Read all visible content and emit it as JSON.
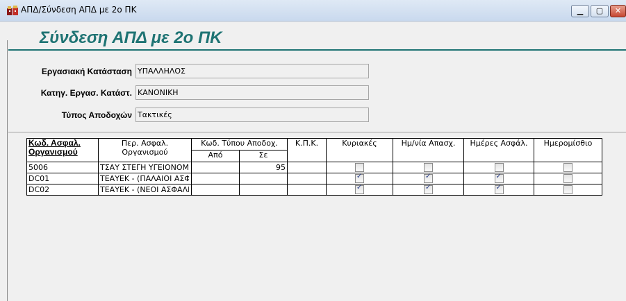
{
  "window": {
    "title": "ΑΠΔ/Σύνδεση ΑΠΔ με 2ο ΠΚ",
    "minimize_glyph": "▁",
    "maximize_glyph": "▢",
    "close_glyph": "✕",
    "icon": "app-icon"
  },
  "form": {
    "heading": "Σύνδεση ΑΠΔ με 2ο ΠΚ",
    "fields": [
      {
        "label": "Εργασιακή Κατάσταση",
        "value": "ΥΠΑΛΛΗΛΟΣ"
      },
      {
        "label": "Κατηγ. Εργασ. Κατάστ.",
        "value": "ΚΑΝΟΝΙΚΗ"
      },
      {
        "label": "Τύπος Αποδοχών",
        "value": "Τακτικές"
      }
    ]
  },
  "grid": {
    "headers": {
      "code": "Κωδ. Ασφαλ. Οργανισμού",
      "desc": "Περ. Ασφαλ. Οργανισμού",
      "type": "Κωδ. Τύπου Αποδοχ.",
      "from": "Από",
      "to": "Σε",
      "kpk": "Κ.Π.Κ.",
      "sundays": "Κυριακές",
      "workdays": "Ημ/νία Απασχ.",
      "insdays": "Ημέρες Ασφάλ.",
      "wage": "Ημερομίσθιο"
    },
    "rows": [
      {
        "code": "5006",
        "desc": "ΤΣΑΥ ΣΤΕΓΗ ΥΓΕΙΟΝΟΜΙΚΩΝ",
        "from": "",
        "to": "95",
        "kpk": "",
        "sundays": false,
        "workdays": false,
        "insdays": false,
        "wage": false
      },
      {
        "code": "DC01",
        "desc": "ΤΕΑΥΕΚ - (ΠΑΛΑΙΟΙ ΑΣΦΑΛΙΣΜΕΝΟΙ)",
        "from": "",
        "to": "",
        "kpk": "",
        "sundays": true,
        "workdays": true,
        "insdays": true,
        "wage": false
      },
      {
        "code": "DC02",
        "desc": "ΤΕΑΥΕΚ - (ΝΕΟΙ ΑΣΦΑΛΙΣΜΕΝΟΙ)",
        "from": "",
        "to": "",
        "kpk": "",
        "sundays": true,
        "workdays": true,
        "insdays": true,
        "wage": false
      }
    ]
  }
}
